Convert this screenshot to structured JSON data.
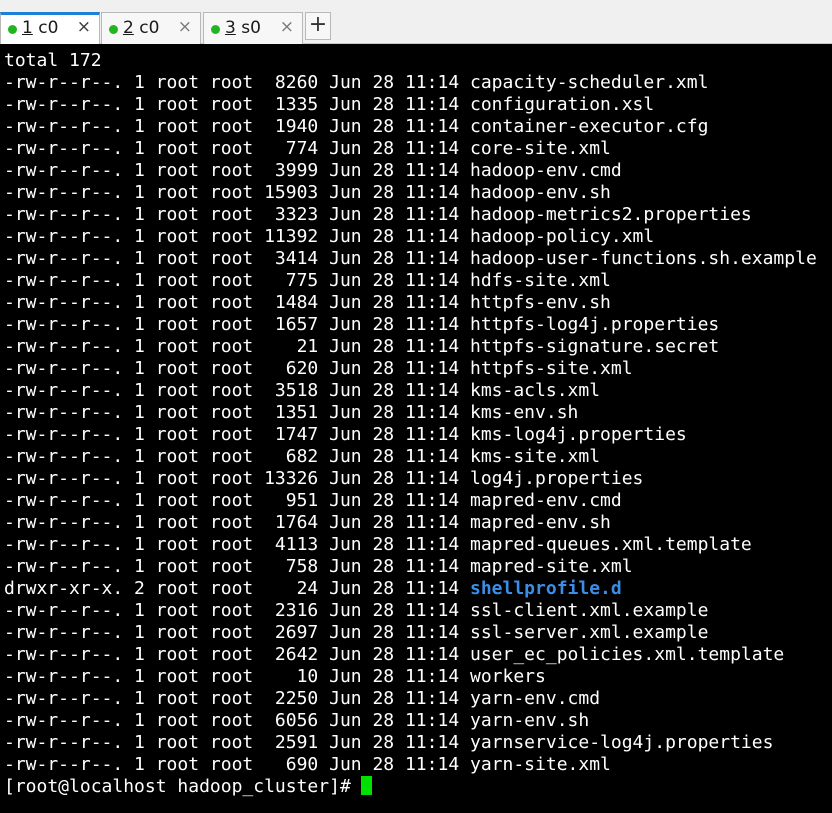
{
  "tabs": [
    {
      "num": "1",
      "name": "c0",
      "active": true
    },
    {
      "num": "2",
      "name": "c0",
      "active": false
    },
    {
      "num": "3",
      "name": "s0",
      "active": false
    }
  ],
  "tab_close_glyph": "×",
  "tab_add_glyph": "+",
  "colors": {
    "active_tab_accent": "#1e7fd8",
    "status_dot": "#22b522",
    "directory_name": "#3a8ee6",
    "cursor": "#00e000"
  },
  "terminal": {
    "total_line": "total 172",
    "entries": [
      {
        "perms": "-rw-r--r--.",
        "links": "1",
        "owner": "root",
        "group": "root",
        "size": "8260",
        "date": "Jun 28 11:14",
        "name": "capacity-scheduler.xml",
        "is_dir": false
      },
      {
        "perms": "-rw-r--r--.",
        "links": "1",
        "owner": "root",
        "group": "root",
        "size": "1335",
        "date": "Jun 28 11:14",
        "name": "configuration.xsl",
        "is_dir": false
      },
      {
        "perms": "-rw-r--r--.",
        "links": "1",
        "owner": "root",
        "group": "root",
        "size": "1940",
        "date": "Jun 28 11:14",
        "name": "container-executor.cfg",
        "is_dir": false
      },
      {
        "perms": "-rw-r--r--.",
        "links": "1",
        "owner": "root",
        "group": "root",
        "size": "774",
        "date": "Jun 28 11:14",
        "name": "core-site.xml",
        "is_dir": false
      },
      {
        "perms": "-rw-r--r--.",
        "links": "1",
        "owner": "root",
        "group": "root",
        "size": "3999",
        "date": "Jun 28 11:14",
        "name": "hadoop-env.cmd",
        "is_dir": false
      },
      {
        "perms": "-rw-r--r--.",
        "links": "1",
        "owner": "root",
        "group": "root",
        "size": "15903",
        "date": "Jun 28 11:14",
        "name": "hadoop-env.sh",
        "is_dir": false
      },
      {
        "perms": "-rw-r--r--.",
        "links": "1",
        "owner": "root",
        "group": "root",
        "size": "3323",
        "date": "Jun 28 11:14",
        "name": "hadoop-metrics2.properties",
        "is_dir": false
      },
      {
        "perms": "-rw-r--r--.",
        "links": "1",
        "owner": "root",
        "group": "root",
        "size": "11392",
        "date": "Jun 28 11:14",
        "name": "hadoop-policy.xml",
        "is_dir": false
      },
      {
        "perms": "-rw-r--r--.",
        "links": "1",
        "owner": "root",
        "group": "root",
        "size": "3414",
        "date": "Jun 28 11:14",
        "name": "hadoop-user-functions.sh.example",
        "is_dir": false
      },
      {
        "perms": "-rw-r--r--.",
        "links": "1",
        "owner": "root",
        "group": "root",
        "size": "775",
        "date": "Jun 28 11:14",
        "name": "hdfs-site.xml",
        "is_dir": false
      },
      {
        "perms": "-rw-r--r--.",
        "links": "1",
        "owner": "root",
        "group": "root",
        "size": "1484",
        "date": "Jun 28 11:14",
        "name": "httpfs-env.sh",
        "is_dir": false
      },
      {
        "perms": "-rw-r--r--.",
        "links": "1",
        "owner": "root",
        "group": "root",
        "size": "1657",
        "date": "Jun 28 11:14",
        "name": "httpfs-log4j.properties",
        "is_dir": false
      },
      {
        "perms": "-rw-r--r--.",
        "links": "1",
        "owner": "root",
        "group": "root",
        "size": "21",
        "date": "Jun 28 11:14",
        "name": "httpfs-signature.secret",
        "is_dir": false
      },
      {
        "perms": "-rw-r--r--.",
        "links": "1",
        "owner": "root",
        "group": "root",
        "size": "620",
        "date": "Jun 28 11:14",
        "name": "httpfs-site.xml",
        "is_dir": false
      },
      {
        "perms": "-rw-r--r--.",
        "links": "1",
        "owner": "root",
        "group": "root",
        "size": "3518",
        "date": "Jun 28 11:14",
        "name": "kms-acls.xml",
        "is_dir": false
      },
      {
        "perms": "-rw-r--r--.",
        "links": "1",
        "owner": "root",
        "group": "root",
        "size": "1351",
        "date": "Jun 28 11:14",
        "name": "kms-env.sh",
        "is_dir": false
      },
      {
        "perms": "-rw-r--r--.",
        "links": "1",
        "owner": "root",
        "group": "root",
        "size": "1747",
        "date": "Jun 28 11:14",
        "name": "kms-log4j.properties",
        "is_dir": false
      },
      {
        "perms": "-rw-r--r--.",
        "links": "1",
        "owner": "root",
        "group": "root",
        "size": "682",
        "date": "Jun 28 11:14",
        "name": "kms-site.xml",
        "is_dir": false
      },
      {
        "perms": "-rw-r--r--.",
        "links": "1",
        "owner": "root",
        "group": "root",
        "size": "13326",
        "date": "Jun 28 11:14",
        "name": "log4j.properties",
        "is_dir": false
      },
      {
        "perms": "-rw-r--r--.",
        "links": "1",
        "owner": "root",
        "group": "root",
        "size": "951",
        "date": "Jun 28 11:14",
        "name": "mapred-env.cmd",
        "is_dir": false
      },
      {
        "perms": "-rw-r--r--.",
        "links": "1",
        "owner": "root",
        "group": "root",
        "size": "1764",
        "date": "Jun 28 11:14",
        "name": "mapred-env.sh",
        "is_dir": false
      },
      {
        "perms": "-rw-r--r--.",
        "links": "1",
        "owner": "root",
        "group": "root",
        "size": "4113",
        "date": "Jun 28 11:14",
        "name": "mapred-queues.xml.template",
        "is_dir": false
      },
      {
        "perms": "-rw-r--r--.",
        "links": "1",
        "owner": "root",
        "group": "root",
        "size": "758",
        "date": "Jun 28 11:14",
        "name": "mapred-site.xml",
        "is_dir": false
      },
      {
        "perms": "drwxr-xr-x.",
        "links": "2",
        "owner": "root",
        "group": "root",
        "size": "24",
        "date": "Jun 28 11:14",
        "name": "shellprofile.d",
        "is_dir": true
      },
      {
        "perms": "-rw-r--r--.",
        "links": "1",
        "owner": "root",
        "group": "root",
        "size": "2316",
        "date": "Jun 28 11:14",
        "name": "ssl-client.xml.example",
        "is_dir": false
      },
      {
        "perms": "-rw-r--r--.",
        "links": "1",
        "owner": "root",
        "group": "root",
        "size": "2697",
        "date": "Jun 28 11:14",
        "name": "ssl-server.xml.example",
        "is_dir": false
      },
      {
        "perms": "-rw-r--r--.",
        "links": "1",
        "owner": "root",
        "group": "root",
        "size": "2642",
        "date": "Jun 28 11:14",
        "name": "user_ec_policies.xml.template",
        "is_dir": false
      },
      {
        "perms": "-rw-r--r--.",
        "links": "1",
        "owner": "root",
        "group": "root",
        "size": "10",
        "date": "Jun 28 11:14",
        "name": "workers",
        "is_dir": false
      },
      {
        "perms": "-rw-r--r--.",
        "links": "1",
        "owner": "root",
        "group": "root",
        "size": "2250",
        "date": "Jun 28 11:14",
        "name": "yarn-env.cmd",
        "is_dir": false
      },
      {
        "perms": "-rw-r--r--.",
        "links": "1",
        "owner": "root",
        "group": "root",
        "size": "6056",
        "date": "Jun 28 11:14",
        "name": "yarn-env.sh",
        "is_dir": false
      },
      {
        "perms": "-rw-r--r--.",
        "links": "1",
        "owner": "root",
        "group": "root",
        "size": "2591",
        "date": "Jun 28 11:14",
        "name": "yarnservice-log4j.properties",
        "is_dir": false
      },
      {
        "perms": "-rw-r--r--.",
        "links": "1",
        "owner": "root",
        "group": "root",
        "size": "690",
        "date": "Jun 28 11:14",
        "name": "yarn-site.xml",
        "is_dir": false
      }
    ],
    "prompt": "[root@localhost hadoop_cluster]#"
  }
}
